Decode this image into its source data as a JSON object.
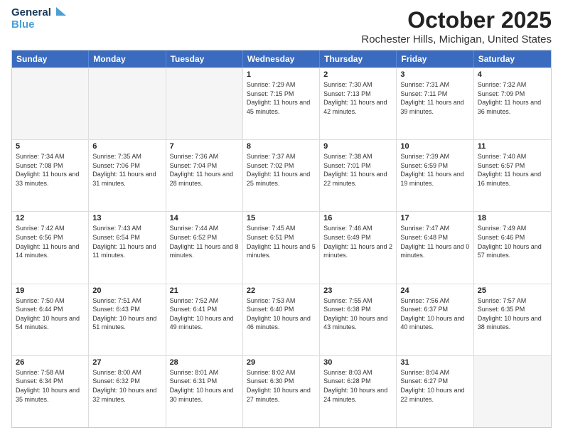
{
  "header": {
    "logo_general": "General",
    "logo_blue": "Blue",
    "title": "October 2025",
    "subtitle": "Rochester Hills, Michigan, United States"
  },
  "days_of_week": [
    "Sunday",
    "Monday",
    "Tuesday",
    "Wednesday",
    "Thursday",
    "Friday",
    "Saturday"
  ],
  "weeks": [
    [
      {
        "day": "",
        "empty": true
      },
      {
        "day": "",
        "empty": true
      },
      {
        "day": "",
        "empty": true
      },
      {
        "day": "1",
        "sunrise": "7:29 AM",
        "sunset": "7:15 PM",
        "daylight": "11 hours and 45 minutes."
      },
      {
        "day": "2",
        "sunrise": "7:30 AM",
        "sunset": "7:13 PM",
        "daylight": "11 hours and 42 minutes."
      },
      {
        "day": "3",
        "sunrise": "7:31 AM",
        "sunset": "7:11 PM",
        "daylight": "11 hours and 39 minutes."
      },
      {
        "day": "4",
        "sunrise": "7:32 AM",
        "sunset": "7:09 PM",
        "daylight": "11 hours and 36 minutes."
      }
    ],
    [
      {
        "day": "5",
        "sunrise": "7:34 AM",
        "sunset": "7:08 PM",
        "daylight": "11 hours and 33 minutes."
      },
      {
        "day": "6",
        "sunrise": "7:35 AM",
        "sunset": "7:06 PM",
        "daylight": "11 hours and 31 minutes."
      },
      {
        "day": "7",
        "sunrise": "7:36 AM",
        "sunset": "7:04 PM",
        "daylight": "11 hours and 28 minutes."
      },
      {
        "day": "8",
        "sunrise": "7:37 AM",
        "sunset": "7:02 PM",
        "daylight": "11 hours and 25 minutes."
      },
      {
        "day": "9",
        "sunrise": "7:38 AM",
        "sunset": "7:01 PM",
        "daylight": "11 hours and 22 minutes."
      },
      {
        "day": "10",
        "sunrise": "7:39 AM",
        "sunset": "6:59 PM",
        "daylight": "11 hours and 19 minutes."
      },
      {
        "day": "11",
        "sunrise": "7:40 AM",
        "sunset": "6:57 PM",
        "daylight": "11 hours and 16 minutes."
      }
    ],
    [
      {
        "day": "12",
        "sunrise": "7:42 AM",
        "sunset": "6:56 PM",
        "daylight": "11 hours and 14 minutes."
      },
      {
        "day": "13",
        "sunrise": "7:43 AM",
        "sunset": "6:54 PM",
        "daylight": "11 hours and 11 minutes."
      },
      {
        "day": "14",
        "sunrise": "7:44 AM",
        "sunset": "6:52 PM",
        "daylight": "11 hours and 8 minutes."
      },
      {
        "day": "15",
        "sunrise": "7:45 AM",
        "sunset": "6:51 PM",
        "daylight": "11 hours and 5 minutes."
      },
      {
        "day": "16",
        "sunrise": "7:46 AM",
        "sunset": "6:49 PM",
        "daylight": "11 hours and 2 minutes."
      },
      {
        "day": "17",
        "sunrise": "7:47 AM",
        "sunset": "6:48 PM",
        "daylight": "11 hours and 0 minutes."
      },
      {
        "day": "18",
        "sunrise": "7:49 AM",
        "sunset": "6:46 PM",
        "daylight": "10 hours and 57 minutes."
      }
    ],
    [
      {
        "day": "19",
        "sunrise": "7:50 AM",
        "sunset": "6:44 PM",
        "daylight": "10 hours and 54 minutes."
      },
      {
        "day": "20",
        "sunrise": "7:51 AM",
        "sunset": "6:43 PM",
        "daylight": "10 hours and 51 minutes."
      },
      {
        "day": "21",
        "sunrise": "7:52 AM",
        "sunset": "6:41 PM",
        "daylight": "10 hours and 49 minutes."
      },
      {
        "day": "22",
        "sunrise": "7:53 AM",
        "sunset": "6:40 PM",
        "daylight": "10 hours and 46 minutes."
      },
      {
        "day": "23",
        "sunrise": "7:55 AM",
        "sunset": "6:38 PM",
        "daylight": "10 hours and 43 minutes."
      },
      {
        "day": "24",
        "sunrise": "7:56 AM",
        "sunset": "6:37 PM",
        "daylight": "10 hours and 40 minutes."
      },
      {
        "day": "25",
        "sunrise": "7:57 AM",
        "sunset": "6:35 PM",
        "daylight": "10 hours and 38 minutes."
      }
    ],
    [
      {
        "day": "26",
        "sunrise": "7:58 AM",
        "sunset": "6:34 PM",
        "daylight": "10 hours and 35 minutes."
      },
      {
        "day": "27",
        "sunrise": "8:00 AM",
        "sunset": "6:32 PM",
        "daylight": "10 hours and 32 minutes."
      },
      {
        "day": "28",
        "sunrise": "8:01 AM",
        "sunset": "6:31 PM",
        "daylight": "10 hours and 30 minutes."
      },
      {
        "day": "29",
        "sunrise": "8:02 AM",
        "sunset": "6:30 PM",
        "daylight": "10 hours and 27 minutes."
      },
      {
        "day": "30",
        "sunrise": "8:03 AM",
        "sunset": "6:28 PM",
        "daylight": "10 hours and 24 minutes."
      },
      {
        "day": "31",
        "sunrise": "8:04 AM",
        "sunset": "6:27 PM",
        "daylight": "10 hours and 22 minutes."
      },
      {
        "day": "",
        "empty": true
      }
    ]
  ]
}
